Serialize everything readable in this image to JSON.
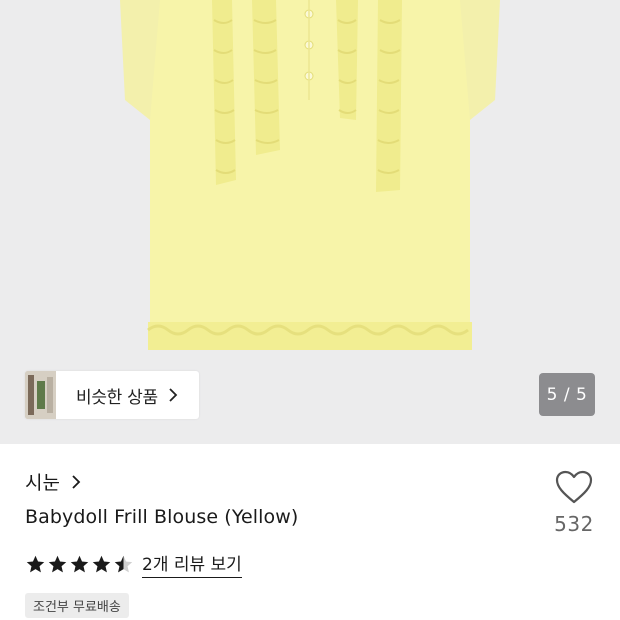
{
  "gallery": {
    "similar_label": "비슷한 상품",
    "page_indicator": "5 / 5",
    "image_icon": "blouse-image"
  },
  "product": {
    "brand": "시눈",
    "name": "Babydoll Frill Blouse (Yellow)",
    "rating": 4.5,
    "review_link": "2개 리뷰 보기",
    "like_count": "532",
    "shipping_badge": "조건부 무료배송"
  },
  "colors": {
    "gallery_bg": "#ececed",
    "blouse": "#f6f3a6",
    "star": "#1a1a1a",
    "indicator_bg": "#8c8c8f"
  }
}
